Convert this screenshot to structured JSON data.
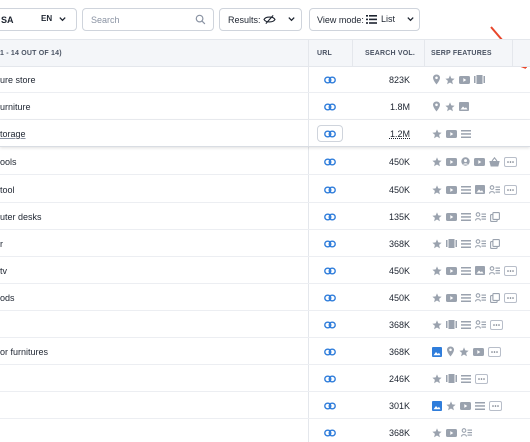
{
  "toolbar": {
    "database_value": "SA",
    "language_value": "EN",
    "search_placeholder": "Search",
    "results_label": "Results:",
    "view_mode_label": "View mode:",
    "view_mode_value": "List"
  },
  "table": {
    "columns": {
      "keyword": "1 - 14 OUT OF 14)",
      "url": "URL",
      "search_volume": "SEARCH VOL.",
      "serp_features": "SERP FEATURES"
    },
    "rows": [
      {
        "keyword": "ure store",
        "volume": "823K",
        "features": [
          "pin-icon",
          "star-icon",
          "video-icon",
          "carousel-icon"
        ],
        "more": false
      },
      {
        "keyword": "urniture",
        "volume": "1.8M",
        "features": [
          "pin-icon",
          "star-icon",
          "image-icon"
        ],
        "more": false
      },
      {
        "keyword": "torage",
        "volume": "1.2M",
        "features": [
          "star-icon",
          "video-icon",
          "list-icon"
        ],
        "more": false
      },
      {
        "keyword": "ools",
        "volume": "450K",
        "features": [
          "star-icon",
          "video-icon",
          "person-icon",
          "video-icon",
          "basket-icon"
        ],
        "more": true
      },
      {
        "keyword": "tool",
        "volume": "450K",
        "features": [
          "star-icon",
          "video-icon",
          "list-icon",
          "image-icon",
          "people-icon"
        ],
        "more": true
      },
      {
        "keyword": "uter desks",
        "volume": "135K",
        "features": [
          "star-icon",
          "video-icon",
          "list-icon",
          "people-icon",
          "copy-icon"
        ],
        "more": false
      },
      {
        "keyword": "r",
        "volume": "368K",
        "features": [
          "star-icon",
          "carousel-icon",
          "list-icon",
          "people-icon",
          "copy-icon"
        ],
        "more": false
      },
      {
        "keyword": "tv",
        "volume": "450K",
        "features": [
          "star-icon",
          "video-icon",
          "list-icon",
          "image-icon",
          "people-icon"
        ],
        "more": true
      },
      {
        "keyword": "ods",
        "volume": "450K",
        "features": [
          "star-icon",
          "video-icon",
          "list-icon",
          "people-icon",
          "copy-icon"
        ],
        "more": true
      },
      {
        "keyword": "",
        "volume": "368K",
        "features": [
          "star-icon",
          "carousel-icon",
          "list-icon",
          "people-icon"
        ],
        "more": true
      },
      {
        "keyword": "or furnitures",
        "volume": "368K",
        "features": [
          "image-blue-icon",
          "pin-icon",
          "star-icon",
          "video-icon"
        ],
        "more": true
      },
      {
        "keyword": "",
        "volume": "246K",
        "features": [
          "star-icon",
          "carousel-icon",
          "list-icon"
        ],
        "more": true
      },
      {
        "keyword": "",
        "volume": "301K",
        "features": [
          "image-blue-icon",
          "star-icon",
          "video-icon",
          "list-icon"
        ],
        "more": true
      },
      {
        "keyword": "",
        "volume": "368K",
        "features": [
          "star-icon",
          "video-icon",
          "people-icon"
        ],
        "more": false
      }
    ]
  },
  "colors": {
    "link_blue": "#2f7ddb",
    "feature_gray": "#9aa2ae",
    "annotation_red": "#e8462b"
  }
}
